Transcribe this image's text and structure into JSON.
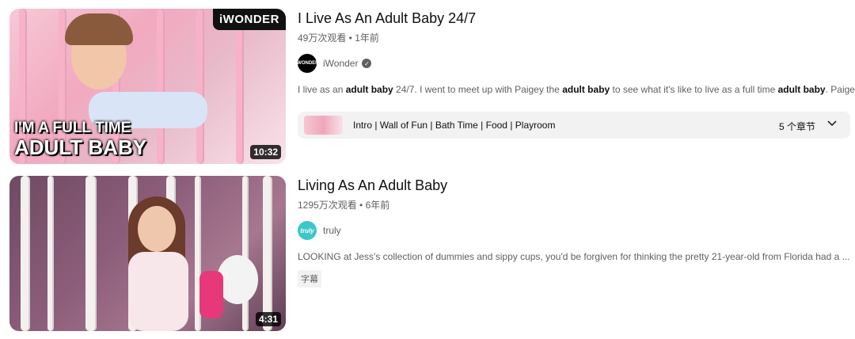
{
  "videos": [
    {
      "title": "I Live As An Adult Baby 24/7",
      "meta": "49万次观看 • 1年前",
      "channel": "iWonder",
      "avatar_text": "iWONDER",
      "thumb_brand": "iWONDER",
      "thumb_line1": "I'M A FULL TIME",
      "thumb_line2": "ADULT BABY",
      "duration": "10:32",
      "desc_parts": [
        "I live as an ",
        "adult baby",
        " 24/7. I went to meet up with Paigey the ",
        "adult baby",
        " to see what it's like to live as a full time ",
        "adult baby",
        ". Paigey ..."
      ],
      "chapters_text": "Intro | Wall of Fun | Bath Time | Food | Playroom",
      "chapters_count": "5 个章节",
      "verified": true
    },
    {
      "title": "Living As An Adult Baby",
      "meta": "1295万次观看 • 6年前",
      "channel": "truly",
      "avatar_text": "truly",
      "duration": "4:31",
      "desc": "LOOKING at Jess's collection of dummies and sippy cups, you'd be forgiven for thinking the pretty 21-year-old from Florida had a ...",
      "badge": "字幕"
    }
  ]
}
